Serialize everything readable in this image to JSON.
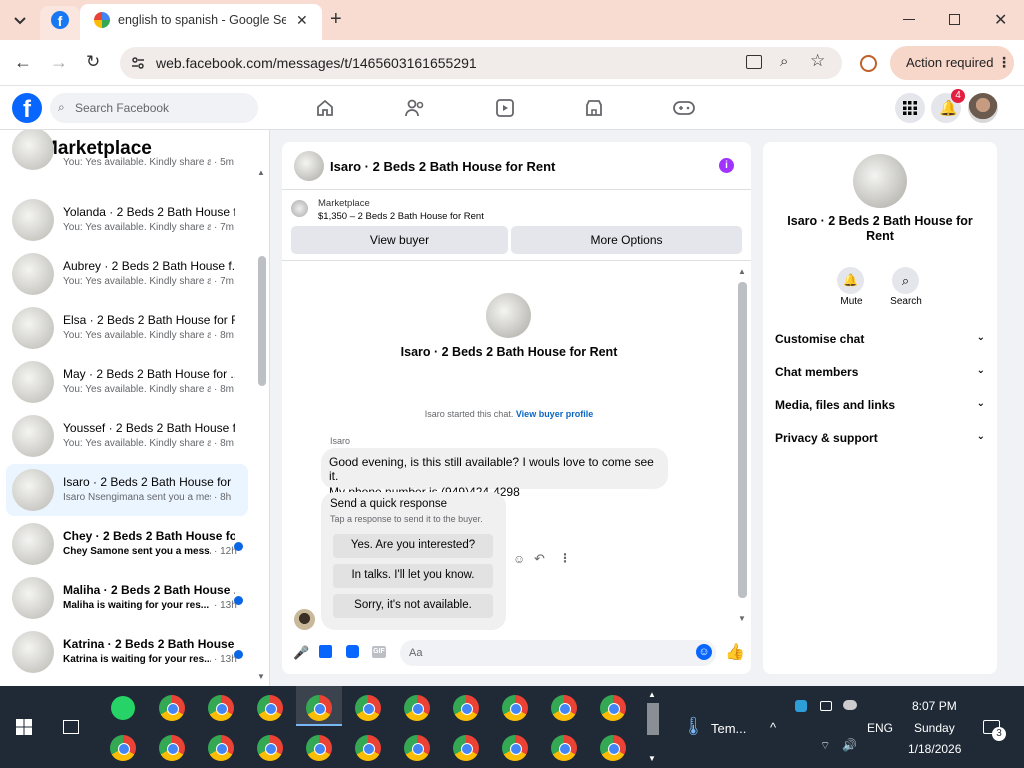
{
  "browser": {
    "tab_title": "english to spanish - Google Sea",
    "url": "web.facebook.com/messages/t/1465603161655291",
    "action_required": "Action required"
  },
  "fb_header": {
    "search_placeholder": "Search Facebook",
    "notification_count": "4"
  },
  "left_panel": {
    "title": "Marketplace",
    "conversations": [
      {
        "name": "",
        "preview": "You: Yes available. Kindly share a c...",
        "time": "5m",
        "unread": false
      },
      {
        "name": "Yolanda · 2 Beds 2 Bath House f...",
        "preview": "You: Yes available. Kindly share a c...",
        "time": "7m",
        "unread": false
      },
      {
        "name": "Aubrey · 2 Beds 2 Bath House f...",
        "preview": "You: Yes available. Kindly share a c...",
        "time": "7m",
        "unread": false
      },
      {
        "name": "Elsa · 2 Beds 2 Bath House for R...",
        "preview": "You: Yes available. Kindly share a c...",
        "time": "8m",
        "unread": false
      },
      {
        "name": "May · 2 Beds 2 Bath House for ...",
        "preview": "You: Yes available. Kindly share a c...",
        "time": "8m",
        "unread": false
      },
      {
        "name": "Youssef · 2 Beds 2 Bath House f...",
        "preview": "You: Yes available. Kindly share a c...",
        "time": "8m",
        "unread": false
      },
      {
        "name": "Isaro · 2 Beds 2 Bath House for ...",
        "preview": "Isaro Nsengimana sent you a mess...",
        "time": "8h",
        "unread": false,
        "active": true
      },
      {
        "name": "Chey · 2 Beds 2 Bath House fo...",
        "preview": "Chey Samone sent you a mess...",
        "time": "12h",
        "unread": true
      },
      {
        "name": "Maliha · 2 Beds 2 Bath House ...",
        "preview": "Maliha is waiting for your res...",
        "time": "13h",
        "unread": true
      },
      {
        "name": "Katrina · 2 Beds 2 Bath House...",
        "preview": "Katrina is waiting for your res...",
        "time": "13h",
        "unread": true
      }
    ]
  },
  "chat": {
    "title": "Isaro · 2 Beds 2 Bath House for Rent",
    "listing_source": "Marketplace",
    "listing_info": "$1,350 – 2 Beds 2 Bath House for Rent",
    "view_buyer": "View buyer",
    "more_options": "More Options",
    "intro_title": "Isaro · 2 Beds 2 Bath House for Rent",
    "started_text": "Isaro started this chat.",
    "view_buyer_profile": "View buyer profile",
    "sender": "Isaro",
    "message_line1": "Good evening, is this still available? I wouls love to come see it.",
    "message_line2": "My phone number is (949)424-4298",
    "quick_title": "Send a quick response",
    "quick_subtitle": "Tap a response to send it to the buyer.",
    "quick_responses": [
      "Yes. Are you interested?",
      "In talks. I'll let you know.",
      "Sorry, it's not available."
    ],
    "composer_placeholder": "Aa"
  },
  "right_panel": {
    "title_line1": "Isaro · 2 Beds 2 Bath House for",
    "title_line2": "Rent",
    "mute": "Mute",
    "search": "Search",
    "sections": [
      "Customise chat",
      "Chat members",
      "Media, files and links",
      "Privacy & support"
    ]
  },
  "taskbar": {
    "weather": "Tem...",
    "lang": "ENG",
    "time": "8:07 PM",
    "day": "Sunday",
    "date": "1/18/2026",
    "notif_count": "3"
  }
}
